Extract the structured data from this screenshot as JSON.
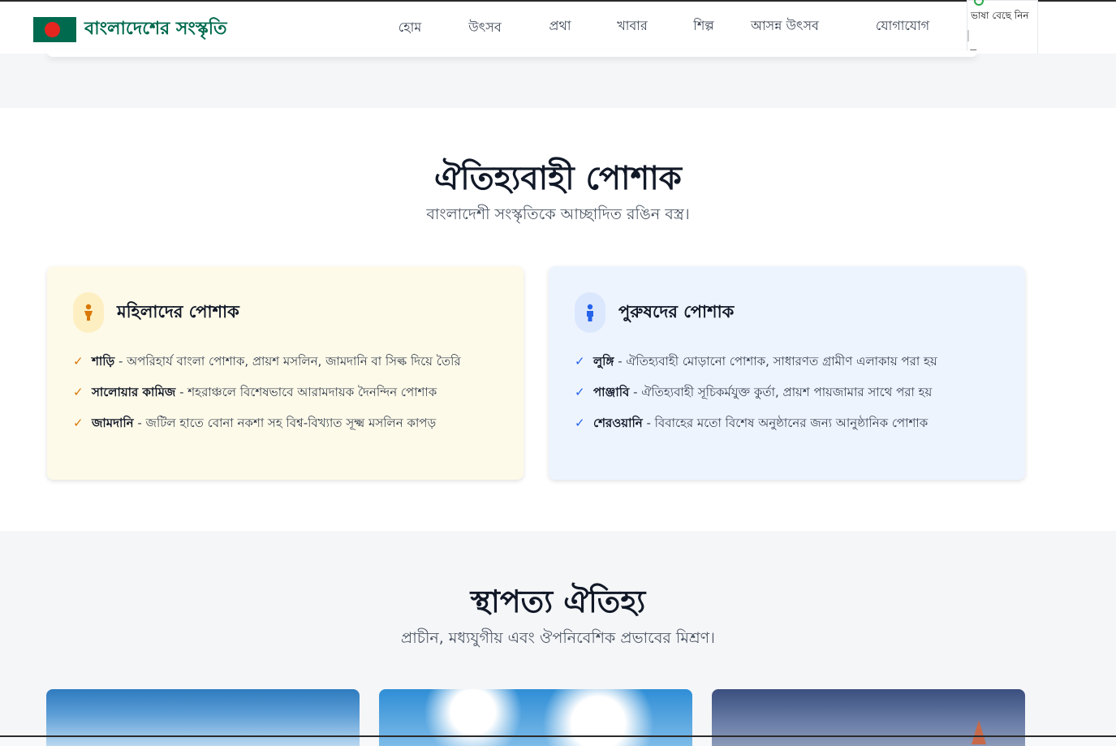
{
  "brand": {
    "title": "বাংলাদেশের সংস্কৃতি",
    "flag_green": "#006a4e",
    "flag_red": "#e5261f"
  },
  "nav": {
    "items": [
      {
        "label": "হোম"
      },
      {
        "label": "উৎসব"
      },
      {
        "label": "প্রথা"
      },
      {
        "label": "খাবার"
      },
      {
        "label": "শিল্প"
      },
      {
        "label": "আসন্ন উৎসব"
      },
      {
        "label": "যোগাযোগ"
      }
    ]
  },
  "language_selector": {
    "label": "ভাষা বেছে নিন",
    "caret": "▼"
  },
  "dress_section": {
    "title": "ঐতিহ্যবাহী পোশাক",
    "subtitle": "বাংলাদেশী সংস্কৃতিকে আচ্ছাদিত রঙিন বস্ত্র।",
    "women": {
      "title": "মহিলাদের পোশাক",
      "icon": "woman-icon",
      "items": [
        {
          "name": "শাড়ি",
          "desc": " - অপরিহার্য বাংলা পোশাক, প্রায়শ মসলিন, জামদানি বা সিল্ক দিয়ে তৈরি"
        },
        {
          "name": "সালোয়ার কামিজ",
          "desc": " - শহরাঞ্চলে বিশেষভাবে আরামদায়ক দৈনন্দিন পোশাক"
        },
        {
          "name": "জামদানি",
          "desc": " - জটিল হাতে বোনা নকশা সহ বিশ্ব-বিখ্যাত সূক্ষ্ম মসলিন কাপড়"
        }
      ]
    },
    "men": {
      "title": "পুরুষদের পোশাক",
      "icon": "man-icon",
      "items": [
        {
          "name": "লুঙ্গি",
          "desc": " - ঐতিহ্যবাহী মোড়ানো পোশাক, সাধারণত গ্রামীণ এলাকায় পরা হয়"
        },
        {
          "name": "পাঞ্জাবি",
          "desc": " - ঐতিহ্যবাহী সূচিকর্মযুক্ত কুর্তা, প্রায়শ পায়জামার সাথে পরা হয়"
        },
        {
          "name": "শেরওয়ানি",
          "desc": " - বিবাহের মতো বিশেষ অনুষ্ঠানের জন্য আনুষ্ঠানিক পোশাক"
        }
      ]
    }
  },
  "architecture_section": {
    "title": "স্থাপত্য ঐতিহ্য",
    "subtitle": "প্রাচীন, মধ্যযুগীয় এবং ঔপনিবেশিক প্রভাবের মিশ্রণ।"
  },
  "colors": {
    "accent": "#006a4e",
    "women_accent": "#d97706",
    "men_accent": "#2563eb"
  }
}
